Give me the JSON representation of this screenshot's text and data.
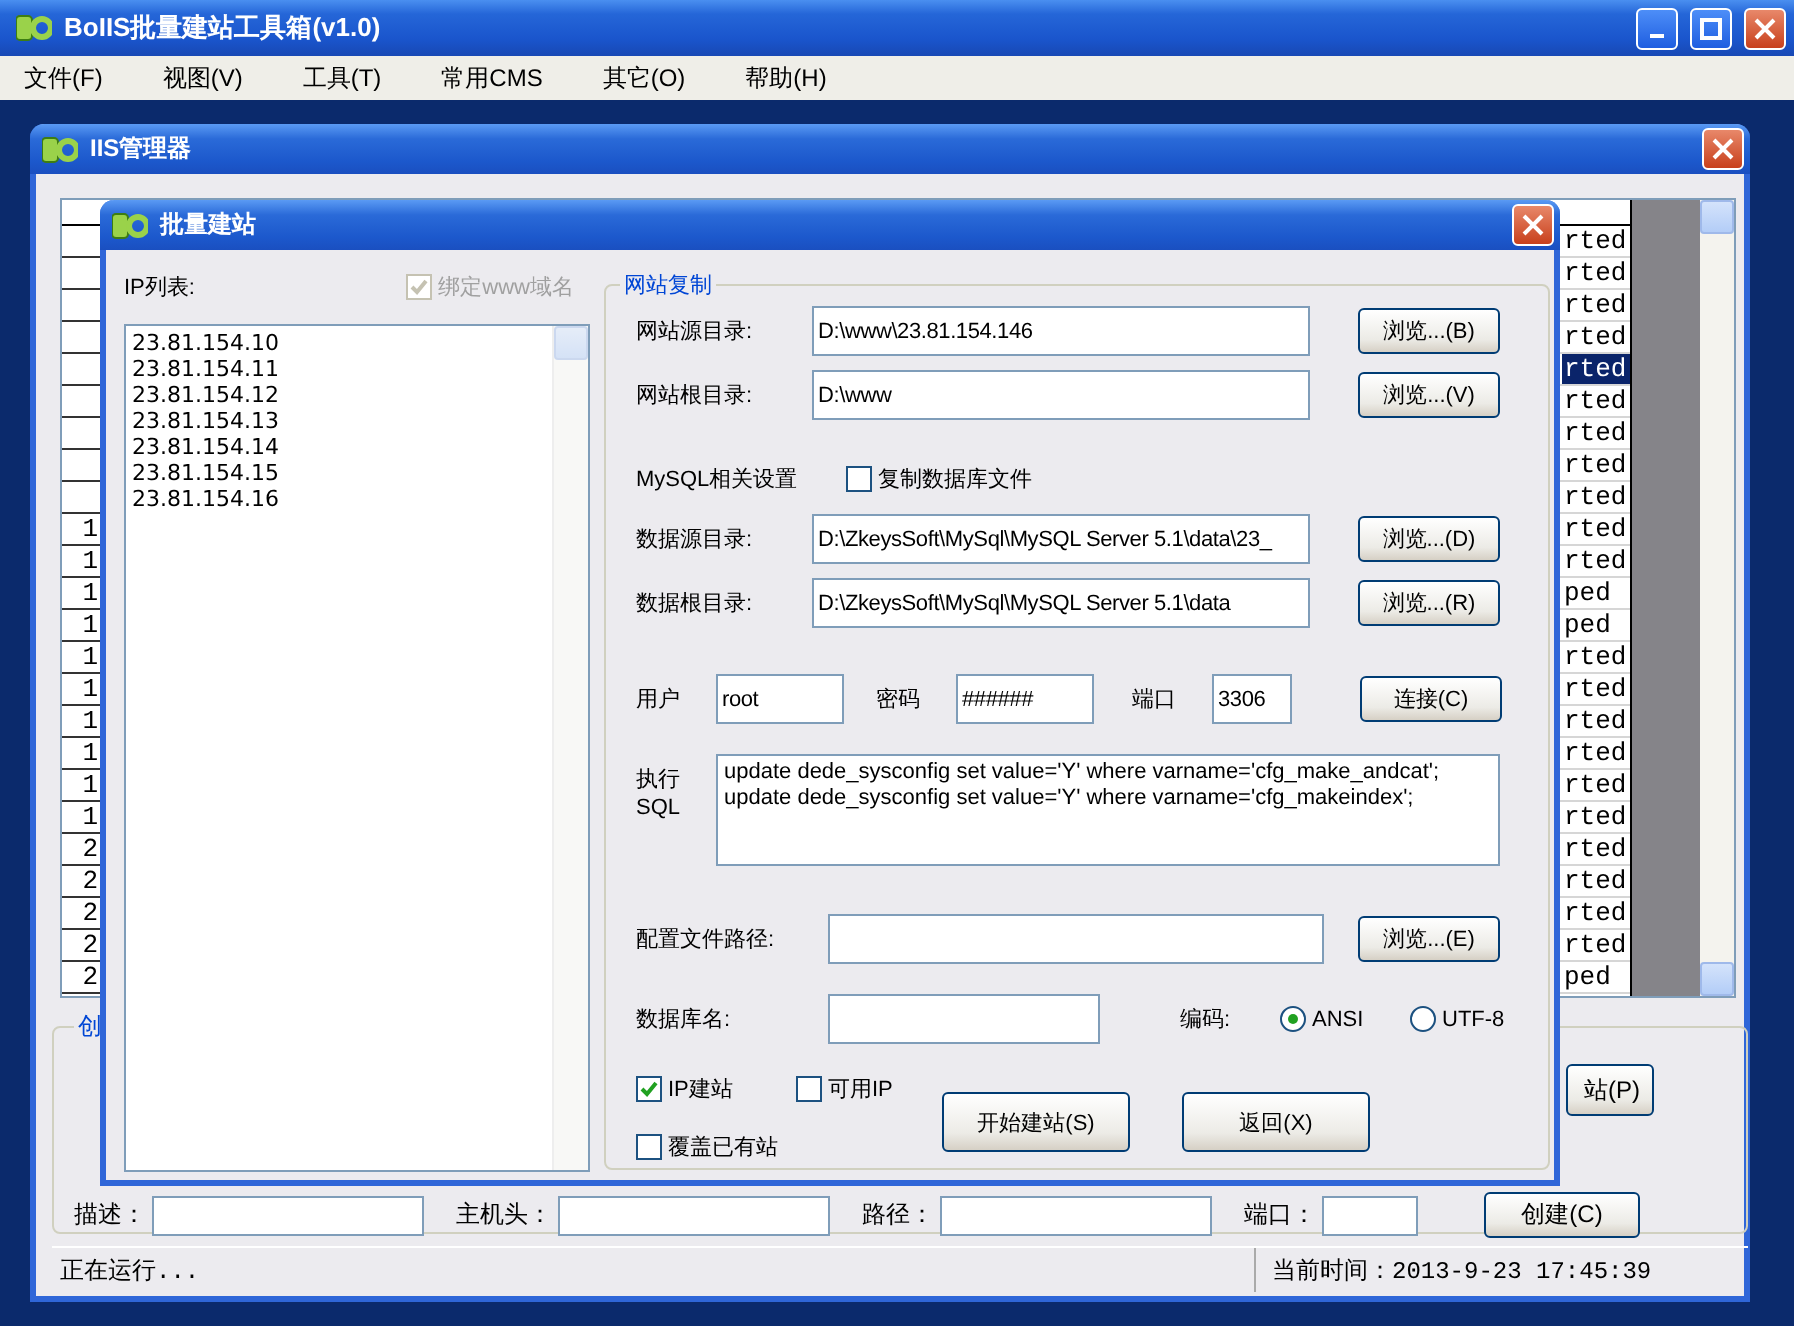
{
  "app_window": {
    "title": "BoIIS批量建站工具箱(v1.0)",
    "menu": [
      "文件(F)",
      "视图(V)",
      "工具(T)",
      "常用CMS",
      "其它(O)",
      "帮助(H)"
    ]
  },
  "iis_window": {
    "title": "IIS管理器",
    "table": {
      "rows": [
        {
          "column_2": "rted",
          "selected": false
        },
        {
          "column_2": "rted",
          "selected": false
        },
        {
          "column_2": "rted",
          "selected": false
        },
        {
          "column_2": "rted",
          "selected": false
        },
        {
          "column_2": "rted",
          "selected": true
        },
        {
          "column_2": "rted",
          "selected": false
        },
        {
          "column_2": "rted",
          "selected": false
        },
        {
          "column_2": "rted",
          "selected": false
        },
        {
          "column_2": "rted",
          "selected": false
        },
        {
          "column_1": "1",
          "column_2": "rted",
          "selected": false
        },
        {
          "column_1": "1",
          "column_2": "rted",
          "selected": false
        },
        {
          "column_1": "1",
          "column_2": "ped",
          "selected": false
        },
        {
          "column_1": "1",
          "column_2": "ped",
          "selected": false
        },
        {
          "column_1": "1",
          "column_2": "rted",
          "selected": false
        },
        {
          "column_1": "1",
          "column_2": "rted",
          "selected": false
        },
        {
          "column_1": "1",
          "column_2": "rted",
          "selected": false
        },
        {
          "column_1": "1",
          "column_2": "rted",
          "selected": false
        },
        {
          "column_1": "1",
          "column_2": "rted",
          "selected": false
        },
        {
          "column_1": "1",
          "column_2": "rted",
          "selected": false
        },
        {
          "column_1": "2",
          "column_2": "rted",
          "selected": false
        },
        {
          "column_1": "2",
          "column_2": "rted",
          "selected": false
        },
        {
          "column_1": "2",
          "column_2": "rted",
          "selected": false
        },
        {
          "column_1": "2",
          "column_2": "rted",
          "selected": false
        },
        {
          "column_1": "2",
          "column_2": "ped",
          "selected": false
        }
      ]
    },
    "group_label": "创",
    "partial_button": "站(P)",
    "fields": [
      {
        "label": "描述："
      },
      {
        "label": "主机头："
      },
      {
        "label": "路径："
      },
      {
        "label": "端口："
      }
    ],
    "create_button": "创建(C)",
    "status_bar": {
      "left": "正在运行...",
      "right": "当前时间：2013-9-23 17:45:39"
    }
  },
  "dialog": {
    "title": "批量建站",
    "ip_list": {
      "label": "IP列表:",
      "bind_www": {
        "label": "绑定www域名",
        "checked": true,
        "disabled": true
      },
      "lines": [
        "23.81.154.10",
        "23.81.154.11",
        "23.81.154.12",
        "23.81.154.13",
        "23.81.154.14",
        "23.81.154.15",
        "23.81.154.16"
      ]
    },
    "site_copy": {
      "legend": "网站复制",
      "site_paths": [
        {
          "label": "网站源目录:",
          "value": "D:\\www\\23.81.154.146",
          "button": "浏览...(B)"
        },
        {
          "label": "网站根目录:",
          "value": "D:\\www",
          "button": "浏览...(V)"
        }
      ],
      "mysql": {
        "label": "MySQL相关设置",
        "copy_db": {
          "label": "复制数据库文件",
          "checked": false
        },
        "paths": [
          {
            "label": "数据源目录:",
            "value": "D:\\ZkeysSoft\\MySql\\MySQL Server 5.1\\data\\23_",
            "button": "浏览...(D)"
          },
          {
            "label": "数据根目录:",
            "value": "D:\\ZkeysSoft\\MySql\\MySQL Server 5.1\\data",
            "button": "浏览...(R)"
          }
        ],
        "user": {
          "label": "用户",
          "value": "root"
        },
        "password": {
          "label": "密码",
          "value": "######"
        },
        "port": {
          "label": "端口",
          "value": "3306"
        },
        "connect_button": "连接(C)"
      },
      "sql": {
        "label": "执行 SQL",
        "lines": [
          "update dede_sysconfig set value='Y' where varname='cfg_make_andcat';",
          "update dede_sysconfig set value='Y' where varname='cfg_makeindex';"
        ]
      },
      "config_path": {
        "label": "配置文件路径:",
        "button": "浏览...(E)"
      },
      "db_name": {
        "label": "数据库名:"
      },
      "encoding": {
        "label": "编码:",
        "options": [
          {
            "label": "ANSI",
            "selected": true
          },
          {
            "label": "UTF-8",
            "selected": false
          }
        ]
      },
      "options": [
        {
          "label": "IP建站",
          "checked": true
        },
        {
          "label": "可用IP",
          "checked": false
        },
        {
          "label": "覆盖已有站",
          "checked": false
        }
      ],
      "buttons": [
        "开始建站(S)",
        "返回(X)"
      ]
    }
  }
}
